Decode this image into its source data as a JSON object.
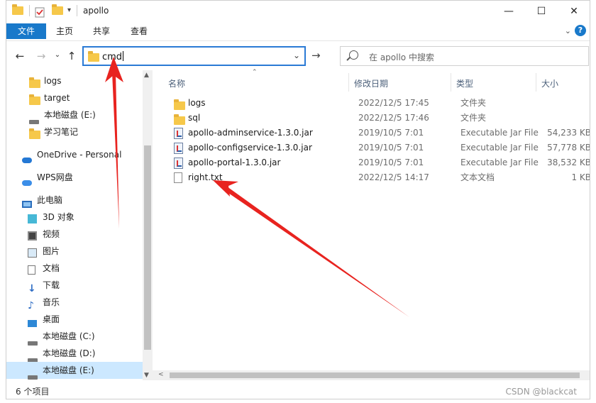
{
  "window": {
    "title": "apollo",
    "controls": {
      "minimize": "—",
      "maximize": "☐",
      "close": "✕"
    }
  },
  "ribbon": {
    "tabs": [
      "文件",
      "主页",
      "共享",
      "查看"
    ],
    "expand": "⌄",
    "help": "?"
  },
  "address": {
    "value": "cmd",
    "dropdown": "⌄",
    "go": "→"
  },
  "search": {
    "placeholder": "在 apollo 中搜索"
  },
  "nav": {
    "items": [
      {
        "label": "logs",
        "icon": "folder-icon"
      },
      {
        "label": "target",
        "icon": "folder-icon"
      },
      {
        "label": "本地磁盘 (E:)",
        "icon": "drive-icon"
      },
      {
        "label": "学习笔记",
        "icon": "folder-icon"
      },
      {
        "label": "OneDrive - Personal",
        "icon": "onedrive-icon"
      },
      {
        "label": "WPS网盘",
        "icon": "cloud-icon"
      },
      {
        "label": "此电脑",
        "icon": "computer-icon"
      },
      {
        "label": "3D 对象",
        "icon": "3d-objects-icon"
      },
      {
        "label": "视频",
        "icon": "video-icon"
      },
      {
        "label": "图片",
        "icon": "pictures-icon"
      },
      {
        "label": "文档",
        "icon": "documents-icon"
      },
      {
        "label": "下载",
        "icon": "download-icon"
      },
      {
        "label": "音乐",
        "icon": "music-icon"
      },
      {
        "label": "桌面",
        "icon": "desktop-icon"
      },
      {
        "label": "本地磁盘 (C:)",
        "icon": "drive-icon"
      },
      {
        "label": "本地磁盘 (D:)",
        "icon": "drive-icon"
      },
      {
        "label": "本地磁盘 (E:)",
        "icon": "drive-icon"
      }
    ],
    "selected_index": 16
  },
  "columns": {
    "name": "名称",
    "date": "修改日期",
    "type": "类型",
    "size": "大小"
  },
  "files": [
    {
      "name": "logs",
      "date": "2022/12/5 17:45",
      "type": "文件夹",
      "size": "",
      "icon": "folder-icon"
    },
    {
      "name": "sql",
      "date": "2022/12/5 17:46",
      "type": "文件夹",
      "size": "",
      "icon": "folder-icon"
    },
    {
      "name": "apollo-adminservice-1.3.0.jar",
      "date": "2019/10/5 7:01",
      "type": "Executable Jar File",
      "size": "54,233 KB",
      "icon": "jar-icon"
    },
    {
      "name": "apollo-configservice-1.3.0.jar",
      "date": "2019/10/5 7:01",
      "type": "Executable Jar File",
      "size": "57,778 KB",
      "icon": "jar-icon"
    },
    {
      "name": "apollo-portal-1.3.0.jar",
      "date": "2019/10/5 7:01",
      "type": "Executable Jar File",
      "size": "38,532 KB",
      "icon": "jar-icon"
    },
    {
      "name": "right.txt",
      "date": "2022/12/5 14:17",
      "type": "文本文档",
      "size": "1 KB",
      "icon": "text-file-icon"
    }
  ],
  "status": {
    "count": "6 个项目",
    "watermark": "CSDN @blackcat"
  },
  "colors": {
    "accent": "#1979ca",
    "annotation": "#e8231f",
    "selected": "#cce8ff"
  }
}
